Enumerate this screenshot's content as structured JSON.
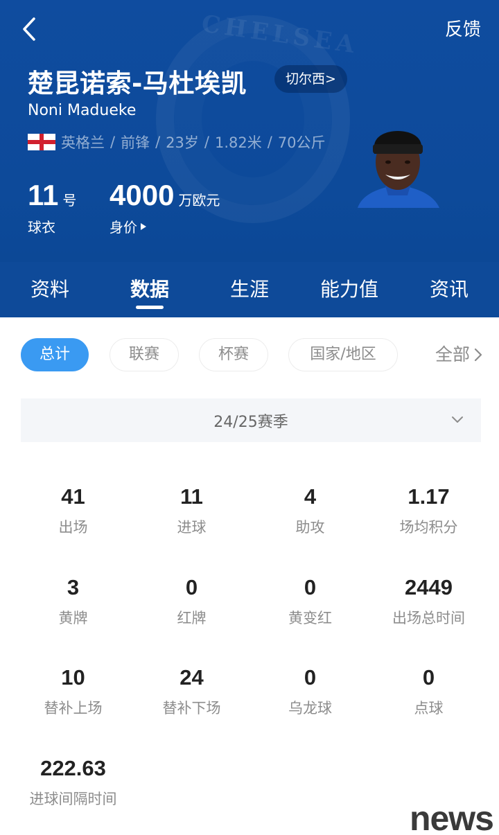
{
  "header": {
    "feedback_label": "反馈",
    "player_name_cn": "楚昆诺索-马杜埃凯",
    "club_tag": "切尔西>",
    "player_name_en": "Noni Madueke",
    "meta": [
      "英格兰",
      "前锋",
      "23岁",
      "1.82米",
      "70公斤"
    ],
    "separator": "/",
    "jersey": {
      "number": "11",
      "unit": "号",
      "caption": "球衣"
    },
    "market_value": {
      "number": "4000",
      "unit": "万欧元",
      "caption": "身价"
    },
    "crest_text": "CHELSEA"
  },
  "tabs": [
    {
      "label": "资料",
      "active": false
    },
    {
      "label": "数据",
      "active": true
    },
    {
      "label": "生涯",
      "active": false
    },
    {
      "label": "能力值",
      "active": false
    },
    {
      "label": "资讯",
      "active": false
    }
  ],
  "filters": {
    "items": [
      "总计",
      "联赛",
      "杯赛",
      "国家/地区"
    ],
    "selected": "总计",
    "more_label": "全部"
  },
  "season": {
    "label": "24/25赛季"
  },
  "stats": [
    {
      "value": "41",
      "label": "出场"
    },
    {
      "value": "11",
      "label": "进球"
    },
    {
      "value": "4",
      "label": "助攻"
    },
    {
      "value": "1.17",
      "label": "场均积分"
    },
    {
      "value": "3",
      "label": "黄牌"
    },
    {
      "value": "0",
      "label": "红牌"
    },
    {
      "value": "0",
      "label": "黄变红"
    },
    {
      "value": "2449",
      "label": "出场总时间"
    },
    {
      "value": "10",
      "label": "替补上场"
    },
    {
      "value": "24",
      "label": "替补下场"
    },
    {
      "value": "0",
      "label": "乌龙球"
    },
    {
      "value": "0",
      "label": "点球"
    },
    {
      "value": "222.63",
      "label": "进球间隔时间"
    }
  ],
  "watermark": "news",
  "colors": {
    "header_bg": "#0f4c9f",
    "accent": "#3a9af2",
    "stat_value": "#222222",
    "stat_label": "#8c8c8c"
  }
}
